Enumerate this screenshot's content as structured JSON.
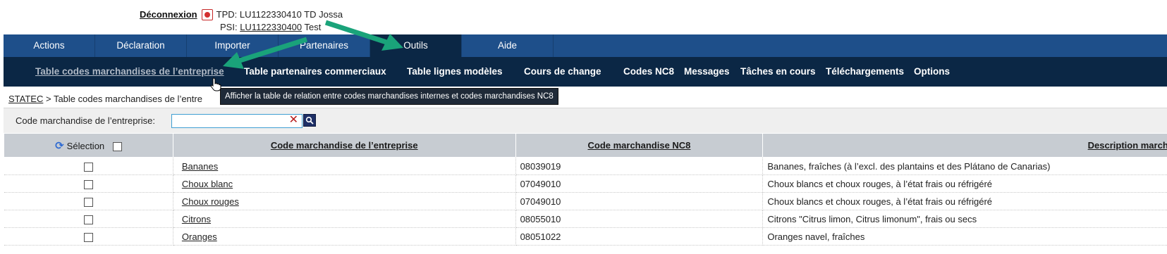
{
  "user": {
    "logout_label": "Déconnexion",
    "tpd": "TPD: LU1122330410 TD Jossa",
    "psi_prefix": "PSI: ",
    "psi_id": "LU1122330400",
    "psi_suffix": " Test"
  },
  "main_nav": {
    "tabs": [
      "Actions",
      "Déclaration",
      "Importer",
      "Partenaires",
      "Outils",
      "Aide"
    ],
    "active": "Outils"
  },
  "sub_nav": {
    "items": [
      "Table codes marchandises de l’entreprise",
      "Table partenaires commerciaux",
      "Table lignes modèles",
      "Cours de change",
      "Codes NC8",
      "Messages",
      "Tâches en cours",
      "Téléchargements",
      "Options"
    ],
    "selected": "Table codes marchandises de l’entreprise"
  },
  "breadcrumb": {
    "root": "STATEC",
    "separator": " > ",
    "current": "Table codes marchandises de l’entre"
  },
  "tooltip": "Afficher la table de relation entre codes marchandises internes et codes marchandises NC8",
  "filter": {
    "label": "Code marchandise de l’entreprise:",
    "value": "",
    "placeholder": ""
  },
  "table": {
    "headers": {
      "selection": "Sélection",
      "company_code": "Code marchandise de l’entreprise",
      "nc8_code": "Code marchandise NC8",
      "description": "Description marcha"
    },
    "rows": [
      {
        "code": "Bananes",
        "nc8": "08039019",
        "desc": "Bananes, fraîches (à l’excl. des plantains et des Plátano de Canarias)"
      },
      {
        "code": "Choux blanc",
        "nc8": "07049010",
        "desc": "Choux blancs et choux rouges, à l’état frais ou réfrigéré"
      },
      {
        "code": "Choux rouges",
        "nc8": "07049010",
        "desc": "Choux blancs et choux rouges, à l’état frais ou réfrigéré"
      },
      {
        "code": "Citrons",
        "nc8": "08055010",
        "desc": "Citrons \"Citrus limon, Citrus limonum\", frais ou secs"
      },
      {
        "code": "Oranges",
        "nc8": "08051022",
        "desc": "Oranges navel, fraîches"
      }
    ]
  },
  "colors": {
    "nav_blue": "#1e4f8a",
    "nav_dark": "#0b2745",
    "annotation_arrow": "#1aa37a"
  }
}
